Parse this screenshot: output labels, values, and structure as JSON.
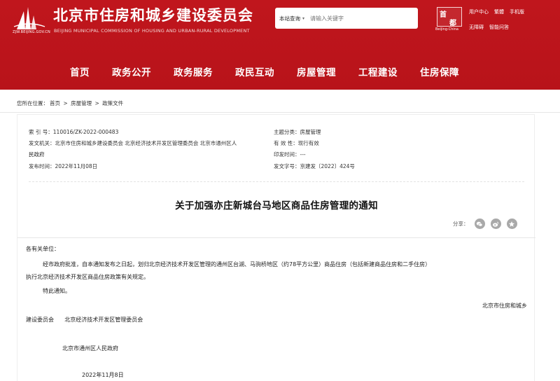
{
  "header": {
    "site_title": "北京市住房和城乡建设委员会",
    "site_subtitle": "BEIJING MUNICIPAL COMMISSION OF HOUSING AND URBAN-RURAL DEVELOPMENT",
    "logo_caption": "ZJW.BEIJING.GOV.CN",
    "search": {
      "scope_label": "本站查询",
      "placeholder": "请输入关键字"
    },
    "badge": {
      "char1": "首",
      "char2": "都",
      "caption": "Beijing·China"
    },
    "links": [
      "用户中心",
      "繁體",
      "手机版",
      "无障碍",
      "智能问答"
    ]
  },
  "nav": {
    "items": [
      "首页",
      "政务公开",
      "政务服务",
      "政民互动",
      "房屋管理",
      "工程建设",
      "住房保障"
    ]
  },
  "breadcrumb": {
    "prefix": "您所在位置：",
    "items": [
      "首页",
      "房屋管理",
      "政策文件"
    ],
    "separator": ">"
  },
  "meta": {
    "index_label": "索 引 号：",
    "index_value": "110016/ZK-2022-000483",
    "issuer_label": "发文机关：",
    "issuer_value_line1": "北京市住房和城乡建设委员会 北京经济技术开发区管理委员会 北京市通州区人",
    "issuer_value_line2": "民政府",
    "date_label": "发布时间：",
    "date_value": "2022年11月08日",
    "topic_label": "主题分类：",
    "topic_value": "房屋管理",
    "validity_label": "有 效 性：",
    "validity_value": "现行有效",
    "print_label": "印发时间：",
    "print_value": "---",
    "docno_label": "发文字号：",
    "docno_value": "京建发〔2022〕424号"
  },
  "document": {
    "title": "关于加强亦庄新城台马地区商品住房管理的通知",
    "share_label": "分享：",
    "salutation": "各有关单位：",
    "para1_line1": "经市政府批准，自本通知发布之日起，划归北京经济技术开发区管理的通州区台湖、马驹桥地区（约78平方公里）商品住房（包括新建商品住房和二手住房）",
    "para1_line2": "执行北京经济技术开发区商品住房政策有关规定。",
    "para2": "特此通知。",
    "sign1": "北京市住房和城乡",
    "sign2": "建设委员会      北京经济技术开发区管理委员会",
    "sign3": "北京市通州区人民政府",
    "sign_date": "2022年11月8日"
  },
  "colors": {
    "brand_red": "#c0161d"
  }
}
